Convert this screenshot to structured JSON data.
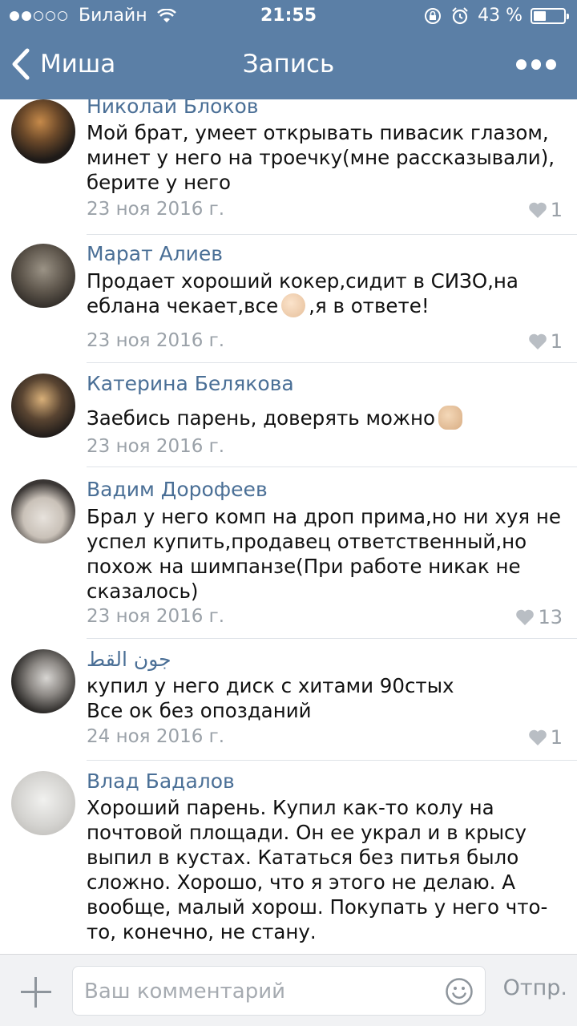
{
  "status_bar": {
    "carrier": "Билайн",
    "time": "21:55",
    "battery": "43 %",
    "battery_level": 0.43
  },
  "nav": {
    "back_label": "Миша",
    "title": "Запись"
  },
  "comments": [
    {
      "author": "Николай Блоков",
      "lines": [
        "Мой брат, умеет открывать пивасик глазом,",
        "минет у него на троечку(мне рассказывали),",
        "берите у него"
      ],
      "date": "23 ноя 2016 г.",
      "likes": "1"
    },
    {
      "author": "Марат Алиев",
      "lines": [
        "Продает хороший кокер,сидит в СИЗО,на",
        "еблана чекает,все",
        ",я в ответе!"
      ],
      "date": "23 ноя 2016 г.",
      "likes": "1"
    },
    {
      "author": "Катерина Белякова",
      "lines": [
        "Заебись парень, доверять можно"
      ],
      "date": "23 ноя 2016 г.",
      "likes": ""
    },
    {
      "author": "Вадим Дорофеев",
      "lines": [
        "Брал у него комп на дроп прима,но ни хуя не",
        "успел купить,продавец ответственный,но",
        "похож на шимпанзе(При работе никак не",
        "сказалось)"
      ],
      "date": "23 ноя 2016 г.",
      "likes": "13"
    },
    {
      "author": "جون القط",
      "lines": [
        "купил у него диск с хитами 90стых",
        "Все ок без опозданий"
      ],
      "date": "24 ноя 2016 г.",
      "likes": "1"
    },
    {
      "author": "Влад Бадалов",
      "lines": [
        "Хороший парень. Купил как-то колу на",
        "почтовой площади. Он ее украл и в крысу",
        "выпил в кустах. Кататься без питья было",
        "сложно. Хорошо, что я этого не делаю. А",
        "вообще, малый хорош. Покупать у него что-",
        "то, конечно, не стану."
      ],
      "date": "",
      "likes": ""
    }
  ],
  "composer": {
    "placeholder": "Ваш комментарий",
    "send_label": "Отпр."
  },
  "colors": {
    "nav_bg": "#5b7fa6",
    "author": "#4a6f96",
    "meta": "#9aa1a8"
  },
  "icons": [
    "back-chevron-icon",
    "more-icon",
    "heart-icon",
    "plus-icon",
    "smile-icon",
    "wifi-icon",
    "lock-rotation-icon",
    "alarm-icon",
    "ok-hand-emoji",
    "thumbs-up-emoji"
  ]
}
